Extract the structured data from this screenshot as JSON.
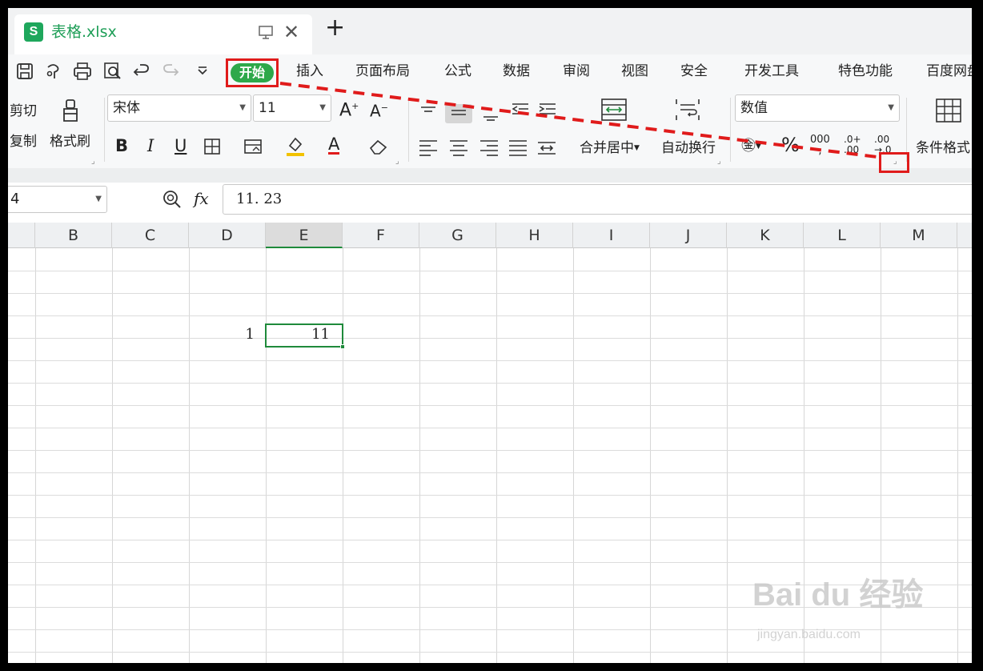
{
  "tabbar": {
    "doc_name": "表格.xlsx",
    "logo_letter": "S",
    "close_symbol": "✕",
    "new_symbol": "+"
  },
  "menu": {
    "start": "开始",
    "items": [
      "插入",
      "页面布局",
      "公式",
      "数据",
      "审阅",
      "视图",
      "安全",
      "开发工具",
      "特色功能",
      "百度网盘"
    ]
  },
  "ribbon": {
    "cut": "剪切",
    "copy": "复制",
    "format_painter": "格式刷",
    "font_name": "宋体",
    "font_size": "11",
    "bold": "B",
    "italic": "I",
    "underline": "U",
    "font_color": "A",
    "merge_center": "合并居中",
    "wrap_text": "自动换行",
    "number_format": "数值",
    "conditional_format": "条件格式",
    "thousand_sep": "000"
  },
  "formula_bar": {
    "name_box": "4",
    "fx": "fx",
    "formula": "11. 23"
  },
  "grid": {
    "columns": [
      "B",
      "C",
      "D",
      "E",
      "F",
      "G",
      "H",
      "I",
      "J",
      "K",
      "L",
      "M"
    ],
    "active_column": "E",
    "cells": {
      "D": "1",
      "E": "11"
    }
  },
  "watermark": {
    "brand": "Bai du 经验",
    "site": "jingyan.baidu.com"
  },
  "colors": {
    "accent": "#1f8a3b",
    "highlight": "#e01b1b"
  }
}
